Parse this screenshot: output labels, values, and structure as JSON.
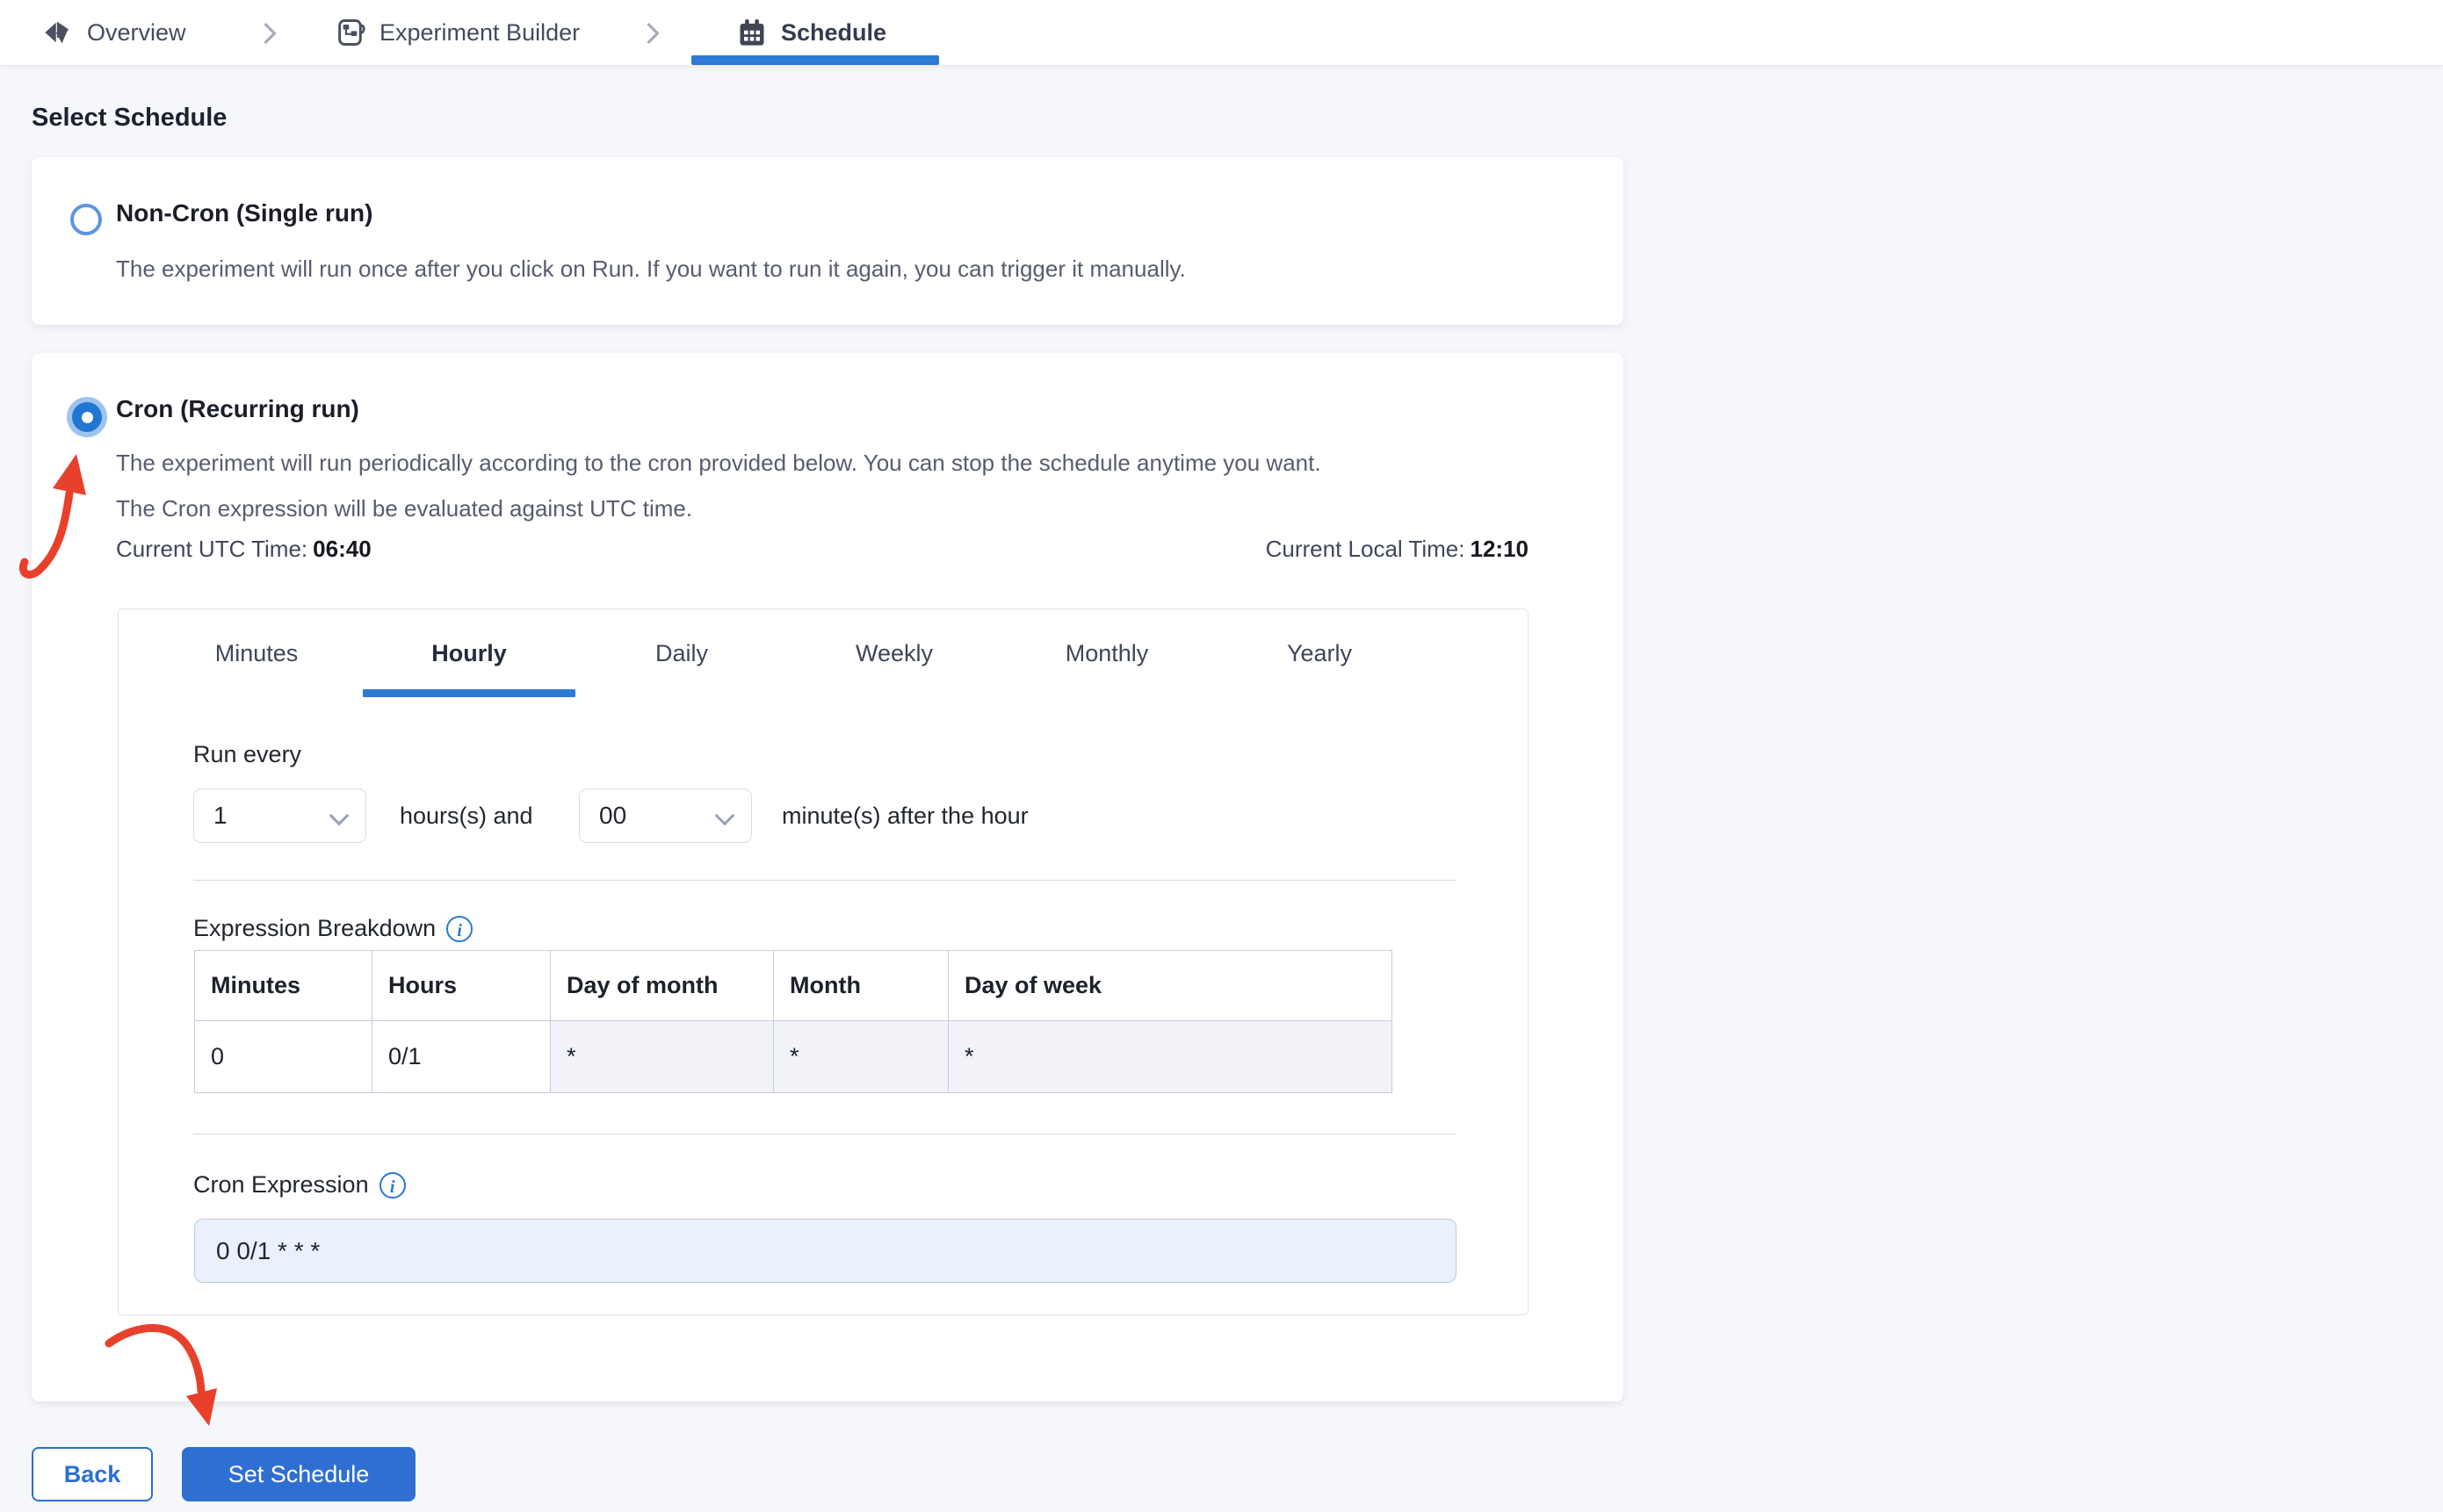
{
  "breadcrumb": {
    "items": [
      {
        "label": "Overview",
        "icon": "overview-icon"
      },
      {
        "label": "Experiment Builder",
        "icon": "experiment-builder-icon"
      },
      {
        "label": "Schedule",
        "icon": "calendar-icon",
        "active": true
      }
    ]
  },
  "page": {
    "heading": "Select Schedule"
  },
  "options": {
    "non_cron": {
      "selected": false,
      "title": "Non-Cron (Single run)",
      "description": "The experiment will run once after you click on Run. If you want to run it again, you can trigger it manually."
    },
    "cron": {
      "selected": true,
      "title": "Cron (Recurring run)",
      "description_line1": "The experiment will run periodically according to the cron provided below. You can stop the schedule anytime you want.",
      "description_line2": "The Cron expression will be evaluated against UTC time.",
      "utc_label": "Current UTC Time:",
      "utc_value": "06:40",
      "local_label": "Current Local Time:",
      "local_value": "12:10"
    }
  },
  "scheduler": {
    "tabs": [
      "Minutes",
      "Hourly",
      "Daily",
      "Weekly",
      "Monthly",
      "Yearly"
    ],
    "active_tab": "Hourly",
    "hourly": {
      "run_every_label": "Run every",
      "hours_value": "1",
      "hours_suffix": "hours(s) and",
      "minutes_value": "00",
      "minutes_suffix": "minute(s) after the hour"
    },
    "expression_breakdown": {
      "label": "Expression Breakdown",
      "info_glyph": "i",
      "columns": [
        "Minutes",
        "Hours",
        "Day of month",
        "Month",
        "Day of week"
      ],
      "values": [
        "0",
        "0/1",
        "*",
        "*",
        "*"
      ]
    },
    "cron_expression": {
      "label": "Cron Expression",
      "info_glyph": "i",
      "value": "0 0/1 * * *"
    }
  },
  "footer": {
    "back_label": "Back",
    "submit_label": "Set Schedule"
  },
  "colors": {
    "primary_blue": "#2f6fd2",
    "tab_underline": "#2d79d6",
    "radio_selected": "#2176d2",
    "radio_halo": "#9dc4ef",
    "info_blue": "#2b78d3",
    "cron_input_bg": "#e9f1fc",
    "annotation_arrow_red": "#e8402a",
    "page_bg": "#f6f7fb"
  }
}
